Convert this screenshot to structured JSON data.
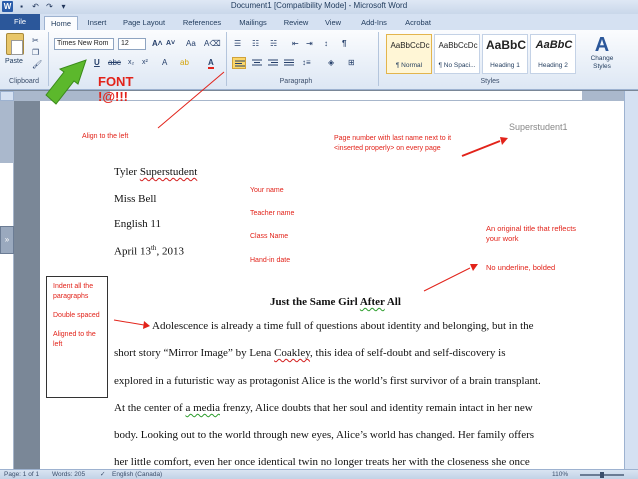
{
  "window": {
    "title": "Document1 [Compatibility Mode] - Microsoft Word"
  },
  "quick_access": {
    "logo": "W",
    "save_icon": "save-icon",
    "undo_icon": "undo-icon",
    "redo_icon": "redo-icon"
  },
  "tabs": [
    "File",
    "Home",
    "Insert",
    "Page Layout",
    "References",
    "Mailings",
    "Review",
    "View",
    "Add-Ins",
    "Acrobat"
  ],
  "ribbon": {
    "clipboard_label": "Clipboard",
    "paste_label": "Paste",
    "font_name": "Times New Rom",
    "font_size": "12",
    "paragraph_label": "Paragraph",
    "styles_label": "Styles",
    "styles": [
      {
        "sample": "AaBbCcDc",
        "name": "¶ Normal"
      },
      {
        "sample": "AaBbCcDc",
        "name": "¶ No Spaci..."
      },
      {
        "sample": "AaBbC",
        "name": "Heading 1"
      },
      {
        "sample": "AaBbC",
        "name": "Heading 2"
      }
    ],
    "change_styles": "Change Styles"
  },
  "document": {
    "header_name": "Superstudent1",
    "author_first": "Tyler ",
    "author_last": "Superstudent",
    "teacher": "Miss Bell",
    "class": "English 11",
    "date_pre": "April 13",
    "date_sup": "th",
    "date_post": ", 2013",
    "title_pre": "Just the Same Girl ",
    "title_mid": "After",
    "title_post": " All",
    "lines": [
      "Adolescence is already a  time full of questions about identity and belonging, but in the",
      "short story “Mirror Image” by Lena ",
      "explored in a  futuristic way as protagonist Alice is the world’s first survivor of a brain transplant.",
      "At the center of ",
      "body. Looking out to the world through new eyes, Alice’s world has changed. Her family offers",
      "her little comfort, even her once identical twin no longer treats her with the closeness she once"
    ],
    "line2_name": "Coakley",
    "line2_post": ", this idea of self-doubt and self-discovery is",
    "line4_squig": "a media",
    "line4_post": " frenzy, Alice doubts that her soul and identity remain intact in her new"
  },
  "annotations": {
    "font_callout_1": "FONT",
    "font_callout_2": "!@!!!",
    "align_left": "Align to the left",
    "page_number": "Page number with last name next to it <inserted properly> on every page",
    "your_name": "Your name",
    "teacher_name": "Teacher name",
    "class_name": "Class Name",
    "hand_in": "Hand-in date",
    "original_title": "An original title that reflects your work",
    "no_underline": "No underline, bolded",
    "box_items": [
      "Indent all the paragraphs",
      "Double spaced",
      "Aligned to the left"
    ]
  },
  "status": {
    "page": "Page: 1 of 1",
    "words": "Words: 205",
    "language": "English (Canada)",
    "zoom": "110%"
  },
  "colors": {
    "annotation_red": "#e2231a",
    "arrow_green": "#5cb82c",
    "file_tab_blue": "#2b579a"
  }
}
